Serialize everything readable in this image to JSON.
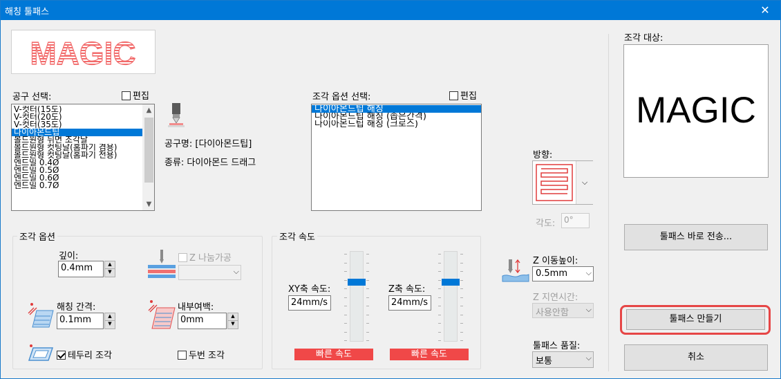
{
  "window": {
    "title": "해칭 툴패스",
    "close_glyph": "✕"
  },
  "preview_logo": {
    "text": "MAGIC",
    "color": "#f26b6b"
  },
  "tool_select": {
    "label": "공구 선택:",
    "edit_label": "편집",
    "items": [
      "V-컷터(15도)",
      "V-컷터(20도)",
      "V-컷터(35도)",
      "다이아몬드팁",
      "볼드원형 뒤면 조각날",
      "볼드원형 컷팅날(홈파기 겸용)",
      "볼드원형 컷팅날(홈파기 전용)",
      "엔드밀 0.4Ø",
      "엔드밀 0.5Ø",
      "엔드밀 0.6Ø",
      "엔드밀 0.7Ø"
    ],
    "selected_index": 3
  },
  "tool_info": {
    "name": "공구명: [다이아몬드팁]",
    "type": "종류: 다이아몬드 드래그"
  },
  "engrave_option_select": {
    "label": "조각 옵션 선택:",
    "edit_label": "편집",
    "items": [
      "다이아몬드팁 해칭",
      "다이아몬드팁 해칭 (좁은간격)",
      "다이아몬드팁 해칭 (크로스)"
    ],
    "selected_index": 0
  },
  "direction": {
    "label": "방향:"
  },
  "angle": {
    "label": "각도:",
    "value": "0°"
  },
  "engrave_options": {
    "group_title": "조각 옵션",
    "depth_label": "깊이:",
    "depth_value": "0.4mm",
    "z_split_label": "Z 나눔가공",
    "z_split_value": "",
    "hatch_gap_label": "해칭 간격:",
    "hatch_gap_value": "0.1mm",
    "inner_margin_label": "내부여백:",
    "inner_margin_value": "0mm",
    "border_engrave_label": "테두리 조각",
    "double_engrave_label": "두번 조각"
  },
  "engrave_speed": {
    "group_title": "조각 속도",
    "xy_label": "XY축 속도:",
    "xy_value": "24mm/s",
    "xy_bar": "빠른 속도",
    "z_label": "Z축 속도:",
    "z_value": "24mm/s",
    "z_bar": "빠른 속도"
  },
  "z_move": {
    "height_label": "Z 이동높이:",
    "height_value": "0.5mm",
    "delay_label": "Z 지연시간:",
    "delay_value": "사용안함"
  },
  "quality": {
    "label": "툴패스 품질:",
    "value": "보통"
  },
  "target": {
    "label": "조각 대상:",
    "text": "MAGIC"
  },
  "buttons": {
    "send": "툴패스 바로 전송...",
    "make": "툴패스 만들기",
    "cancel": "취소"
  },
  "colors": {
    "title_bar": "#0078d7",
    "selection": "#0078d7",
    "speed_bar": "#f04848",
    "highlight": "#e64646"
  }
}
